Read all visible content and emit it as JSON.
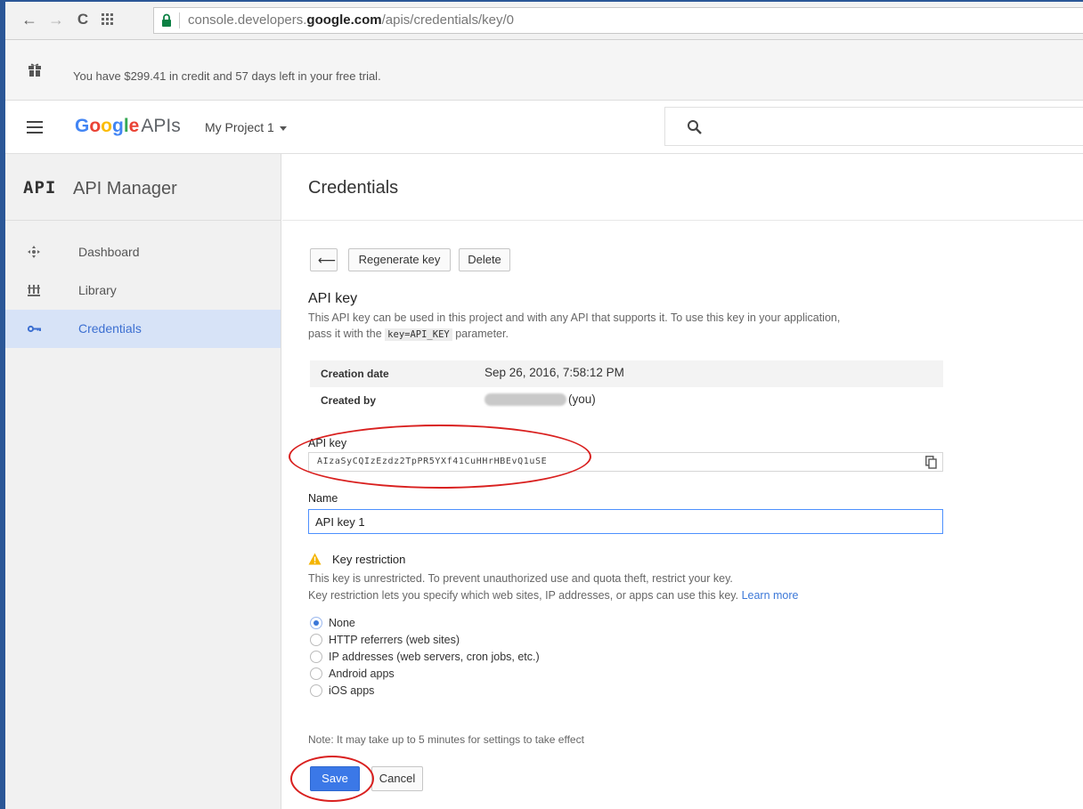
{
  "browser": {
    "url_prefix": "console.developers.",
    "url_domain": "google.com",
    "url_path": "/apis/credentials/key/0",
    "back_glyph": "←",
    "forward_glyph": "→",
    "reload_glyph": "C"
  },
  "trial_banner": {
    "text": "You have $299.41 in credit and 57 days left in your free trial."
  },
  "header": {
    "brand_letters": [
      {
        "ch": "G",
        "color": "#4285f4"
      },
      {
        "ch": "o",
        "color": "#ea4335"
      },
      {
        "ch": "o",
        "color": "#fbbc05"
      },
      {
        "ch": "g",
        "color": "#4285f4"
      },
      {
        "ch": "l",
        "color": "#34a853"
      },
      {
        "ch": "e",
        "color": "#ea4335"
      }
    ],
    "brand_suffix": "APIs",
    "project": "My Project 1"
  },
  "sidebar": {
    "logo": "API",
    "title": "API Manager",
    "items": [
      {
        "label": "Dashboard",
        "icon": "dashboard-icon",
        "active": false
      },
      {
        "label": "Library",
        "icon": "library-icon",
        "active": false
      },
      {
        "label": "Credentials",
        "icon": "key-icon",
        "active": true
      }
    ]
  },
  "main": {
    "title": "Credentials",
    "toolbar": {
      "back_glyph": "⟵",
      "regenerate_label": "Regenerate key",
      "delete_label": "Delete"
    },
    "section_title": "API key",
    "section_desc_1": "This API key can be used in this project and with any API that supports it. To use this key in your application,",
    "section_desc_2_pre": "pass it with the",
    "section_desc_code": "key=API_KEY",
    "section_desc_2_post": "parameter.",
    "info": {
      "creation_label": "Creation date",
      "creation_value": "Sep 26, 2016, 7:58:12 PM",
      "created_by_label": "Created by",
      "created_by_value": "(you)"
    },
    "api_key_label": "API key",
    "api_key_value": "AIzaSyCQIzEzdz2TpPR5YXf41CuHHrHBEvQ1uSE",
    "name_label": "Name",
    "name_value": "API key 1",
    "restriction": {
      "title": "Key restriction",
      "desc_1": "This key is unrestricted. To prevent unauthorized use and quota theft, restrict your key.",
      "desc_2": "Key restriction lets you specify which web sites, IP addresses, or apps can use this key.",
      "learn_more": "Learn more",
      "options": [
        {
          "label": "None",
          "selected": true
        },
        {
          "label": "HTTP referrers (web sites)",
          "selected": false
        },
        {
          "label": "IP addresses (web servers, cron jobs, etc.)",
          "selected": false
        },
        {
          "label": "Android apps",
          "selected": false
        },
        {
          "label": "iOS apps",
          "selected": false
        }
      ]
    },
    "note": "Note: It may take up to 5 minutes for settings to take effect",
    "save_label": "Save",
    "cancel_label": "Cancel"
  },
  "colors": {
    "accent": "#3b78e7",
    "active_nav_bg": "#d7e3f7",
    "annotation_red": "#d9201f",
    "lock_green": "#0b8043",
    "warning_amber": "#f4b400"
  }
}
